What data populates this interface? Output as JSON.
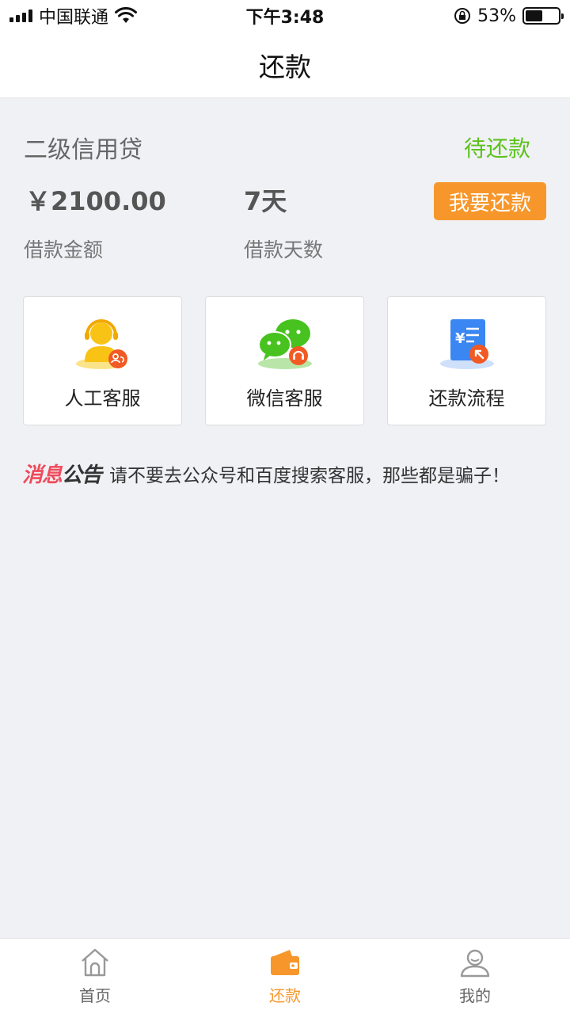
{
  "status_bar": {
    "carrier": "中国联通",
    "time": "下午3:48",
    "battery_percent": "53%",
    "battery_level": 0.53
  },
  "nav": {
    "title": "还款"
  },
  "loan": {
    "name": "二级信用贷",
    "status": "待还款",
    "amount": "￥2100.00",
    "amount_label": "借款金额",
    "days": "7天",
    "days_label": "借款天数",
    "repay_button": "我要还款"
  },
  "services": [
    {
      "label": "人工客服",
      "icon": "customer-service-icon"
    },
    {
      "label": "微信客服",
      "icon": "wechat-icon"
    },
    {
      "label": "还款流程",
      "icon": "repayment-process-icon"
    }
  ],
  "notice": {
    "tag_part1": "消息",
    "tag_part2": "公告",
    "text": "请不要去公众号和百度搜索客服，那些都是骗子！"
  },
  "tabbar": {
    "items": [
      {
        "label": "首页",
        "icon": "home-icon",
        "active": false
      },
      {
        "label": "还款",
        "icon": "wallet-icon",
        "active": true
      },
      {
        "label": "我的",
        "icon": "profile-icon",
        "active": false
      }
    ]
  },
  "colors": {
    "accent_orange": "#f7972b",
    "status_green": "#5cc21c",
    "notice_red": "#ef4b5c"
  }
}
